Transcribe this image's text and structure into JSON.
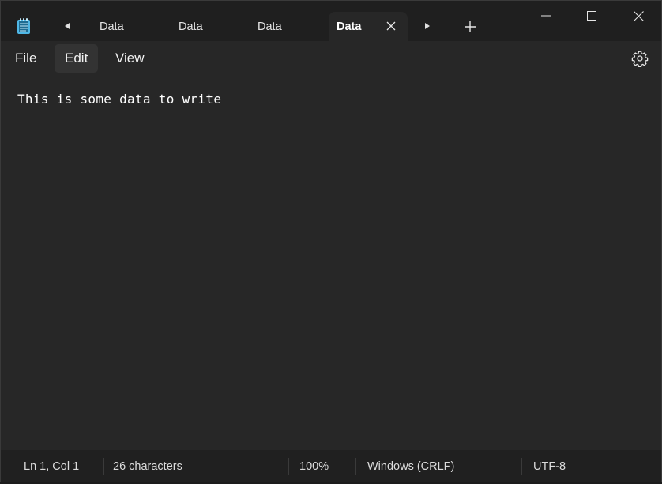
{
  "titlebar": {
    "tabs": [
      {
        "label": "Data"
      },
      {
        "label": "Data"
      },
      {
        "label": "Data"
      },
      {
        "label": "Data",
        "active": true
      }
    ]
  },
  "menu": {
    "file": "File",
    "edit": "Edit",
    "view": "View"
  },
  "editor": {
    "content": "This is some data to write"
  },
  "status": {
    "position": "Ln 1, Col 1",
    "characters": "26 characters",
    "zoom": "100%",
    "line_endings": "Windows (CRLF)",
    "encoding": "UTF-8"
  },
  "icons": {
    "app": "notepad-icon",
    "settings": "gear-icon"
  },
  "colors": {
    "background": "#272727",
    "titlebar": "#1f1f1f",
    "statusbar": "#202020",
    "app_icon": "#4fb7e6"
  }
}
